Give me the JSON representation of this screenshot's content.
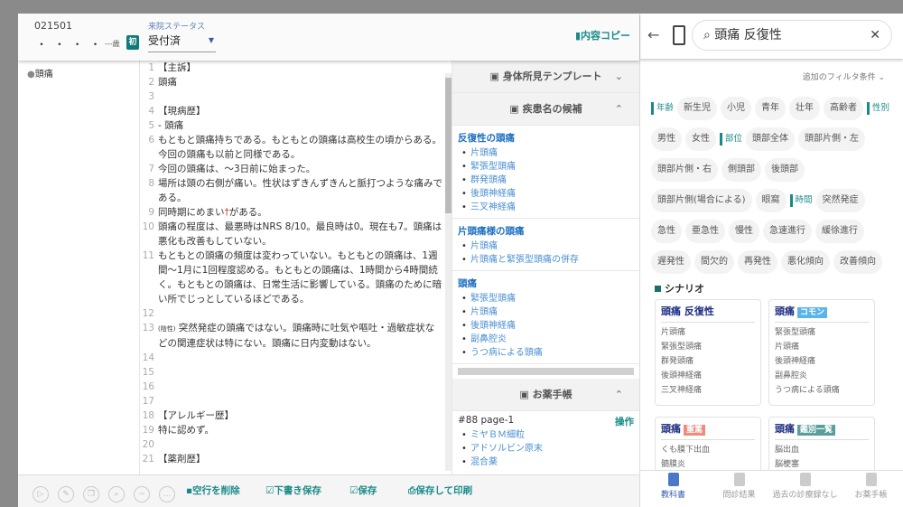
{
  "header": {
    "patient_id": "021501",
    "name_dots": "・ ・  ・ ・",
    "age": "---歳",
    "first_badge": "初",
    "status_label": "来院ステータス",
    "status_value": "受付済",
    "copy_button": "内容コピー"
  },
  "sidebar": {
    "items": [
      "頭痛"
    ]
  },
  "editor": {
    "lines": [
      {
        "n": "1",
        "text": "【主訴】"
      },
      {
        "n": "2",
        "text": "頭痛"
      },
      {
        "n": "3",
        "text": ""
      },
      {
        "n": "4",
        "text": "【現病歴】"
      },
      {
        "n": "5",
        "text": "- 頭痛"
      },
      {
        "n": "6",
        "text": "もともと頭痛持ちである。もともとの頭痛は高校生の頃からある。今回の頭痛も以前と同様である。"
      },
      {
        "n": "7",
        "text": "今回の頭痛は、〜3日前に始まった。"
      },
      {
        "n": "8",
        "text": "場所は頭の右側が痛い。性状はずきんずきんと脈打つような痛みである。"
      },
      {
        "n": "9",
        "text": "同時期にめまい",
        "mark": "†",
        "after": "がある。"
      },
      {
        "n": "10",
        "text": "頭痛の程度は、最悪時はNRS 8/10。最良時は0。現在も7。頭痛は悪化も改善もしていない。"
      },
      {
        "n": "11",
        "text": "もともとの頭痛の頻度は変わっていない。もともとの頭痛は、1週間〜1月に1回程度認める。もともとの頭痛は、1時間から4時間続く。もともとの頭痛は、日常生活に影響している。頭痛のために暗い所でじっとしているほどである。"
      },
      {
        "n": "12",
        "text": ""
      },
      {
        "n": "13",
        "prefix": "(陰性)",
        "text": " 突然発症の頭痛ではない。頭痛時に吐気や嘔吐・過敏症状などの関連症状は特にない。頭痛に日内変動はない。"
      },
      {
        "n": "14",
        "text": ""
      },
      {
        "n": "15",
        "text": ""
      },
      {
        "n": "16",
        "text": ""
      },
      {
        "n": "17",
        "text": ""
      },
      {
        "n": "18",
        "text": "【アレルギー歴】"
      },
      {
        "n": "19",
        "text": "特に認めず。"
      },
      {
        "n": "20",
        "text": ""
      },
      {
        "n": "21",
        "text": "【薬剤歴】"
      }
    ]
  },
  "middle": {
    "physical_template": "身体所見テンプレート",
    "disease_candidates": "疾患名の候補",
    "groups": [
      {
        "title": "反復性の頭痛",
        "items": [
          "片頭痛",
          "緊張型頭痛",
          "群発頭痛",
          "後頭神経痛",
          "三叉神経痛"
        ]
      },
      {
        "title": "片頭痛様の頭痛",
        "items": [
          "片頭痛",
          "片頭痛と緊張型頭痛の併存"
        ]
      },
      {
        "title": "頭痛",
        "items": [
          "緊張型頭痛",
          "片頭痛",
          "後頭神経痛",
          "副鼻腔炎",
          "うつ病による頭痛"
        ]
      }
    ],
    "medicine_book": "お薬手帳",
    "med_page": "#88 page-1",
    "med_action": "操作",
    "meds": [
      "ミヤＢＭ細粒",
      "アドソルビン原末",
      "混合薬"
    ]
  },
  "footer": {
    "delete_blank": "空行を削除",
    "draft_save": "下書き保存",
    "save": "保存",
    "save_print": "保存して印刷"
  },
  "right": {
    "search_value": "頭痛 反復性",
    "additional_filter": "追加のフィルタ条件",
    "tags": [
      {
        "cat": "年齢"
      },
      {
        "t": "新生児"
      },
      {
        "t": "小児"
      },
      {
        "t": "青年"
      },
      {
        "t": "壮年"
      },
      {
        "t": "高齢者"
      },
      {
        "cat": "性別"
      },
      {
        "t": "男性"
      },
      {
        "t": "女性"
      },
      {
        "cat": "部位"
      },
      {
        "t": "頭部全体"
      },
      {
        "t": "頭部片側・左"
      },
      {
        "t": "頭部片側・右"
      },
      {
        "t": "側頭部"
      },
      {
        "t": "後頭部"
      },
      {
        "t": "頭部片側(場合による)"
      },
      {
        "t": "眼窩"
      },
      {
        "cat": "時間"
      },
      {
        "t": "突然発症"
      },
      {
        "t": "急性"
      },
      {
        "t": "亜急性"
      },
      {
        "t": "慢性"
      },
      {
        "t": "急速進行"
      },
      {
        "t": "緩徐進行"
      },
      {
        "t": "遅発性"
      },
      {
        "t": "間欠的"
      },
      {
        "t": "再発性"
      },
      {
        "t": "悪化傾向"
      },
      {
        "t": "改善傾向"
      }
    ],
    "scenario_label": "シナリオ",
    "cards": [
      {
        "title": "頭痛 反復性",
        "badge": "",
        "items": [
          "片頭痛",
          "緊張型頭痛",
          "群発頭痛",
          "後頭神経痛",
          "三叉神経痛"
        ]
      },
      {
        "title": "頭痛",
        "badge": "コモン",
        "badge_color": "#5ab4e8",
        "items": [
          "緊張型頭痛",
          "片頭痛",
          "後頭神経痛",
          "副鼻腔炎",
          "うつ病による頭痛"
        ]
      },
      {
        "title": "頭痛",
        "badge": "重篤",
        "badge_color": "#f08a7a",
        "items": [
          "くも膜下出血",
          "髄膜炎"
        ]
      },
      {
        "title": "頭痛",
        "badge": "鑑別一覧",
        "badge_color": "#5a9e9c",
        "items": [
          "脳出血",
          "脳梗塞"
        ]
      }
    ],
    "nav": [
      "教科書",
      "問診結果",
      "過去の診療録なし",
      "お薬手帳"
    ]
  }
}
